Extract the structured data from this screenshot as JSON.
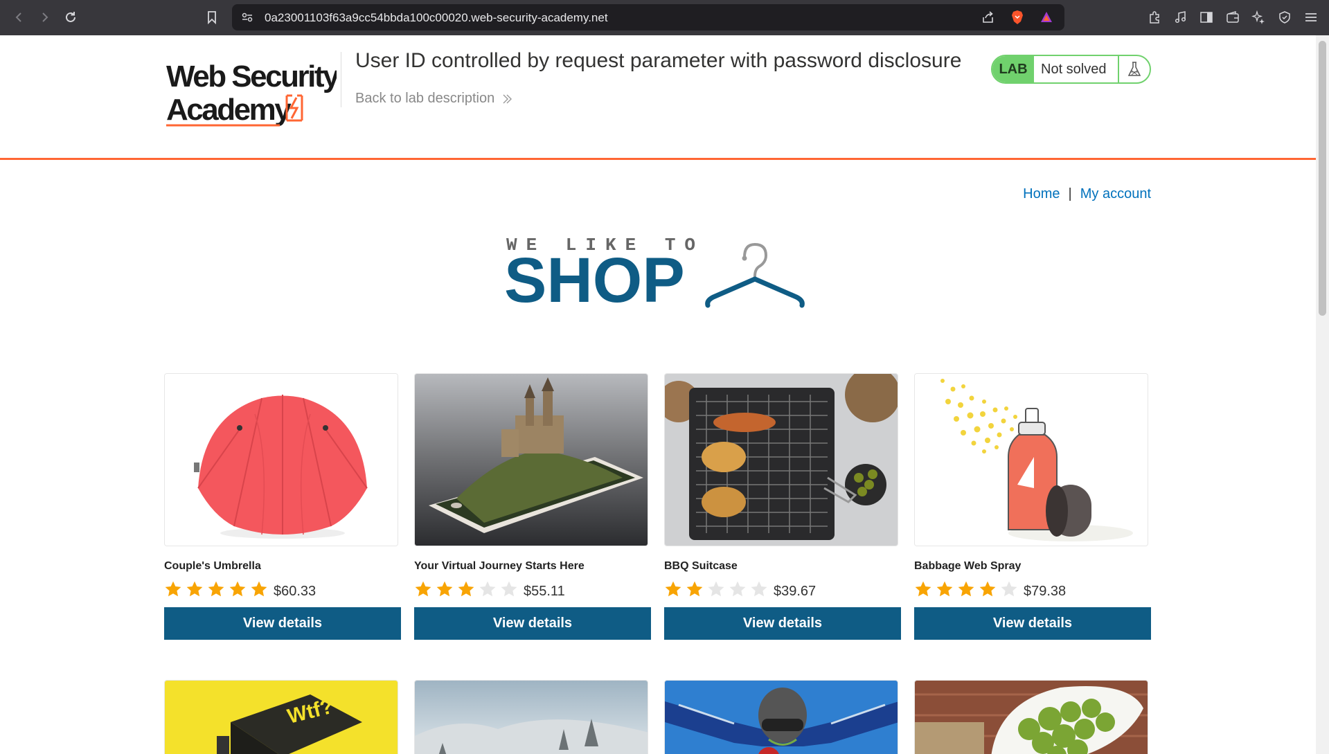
{
  "browser": {
    "url": "0a23001103f63a9cc54bbda100c00020.web-security-academy.net"
  },
  "header": {
    "logo_line1": "Web Security",
    "logo_line2": "Academy",
    "lab_title": "User ID controlled by request parameter with password disclosure",
    "back_link": "Back to lab description",
    "lab_badge": "LAB",
    "lab_status": "Not solved"
  },
  "nav": {
    "home": "Home",
    "separator": "|",
    "my_account": "My account"
  },
  "banner": {
    "tagline": "WE LIKE TO",
    "shop": "SHOP"
  },
  "products": [
    {
      "name": "Couple's Umbrella",
      "rating": 5,
      "price": "$60.33",
      "button": "View details"
    },
    {
      "name": "Your Virtual Journey Starts Here",
      "rating": 3,
      "price": "$55.11",
      "button": "View details"
    },
    {
      "name": "BBQ Suitcase",
      "rating": 2,
      "price": "$39.67",
      "button": "View details"
    },
    {
      "name": "Babbage Web Spray",
      "rating": 4,
      "price": "$79.38",
      "button": "View details"
    }
  ],
  "colors": {
    "accent_orange": "#ff6633",
    "button_blue": "#0f5c85",
    "link_blue": "#0071bc",
    "lab_green": "#70d16d",
    "star_gold": "#f8a404",
    "star_empty": "#e5e5e5"
  }
}
